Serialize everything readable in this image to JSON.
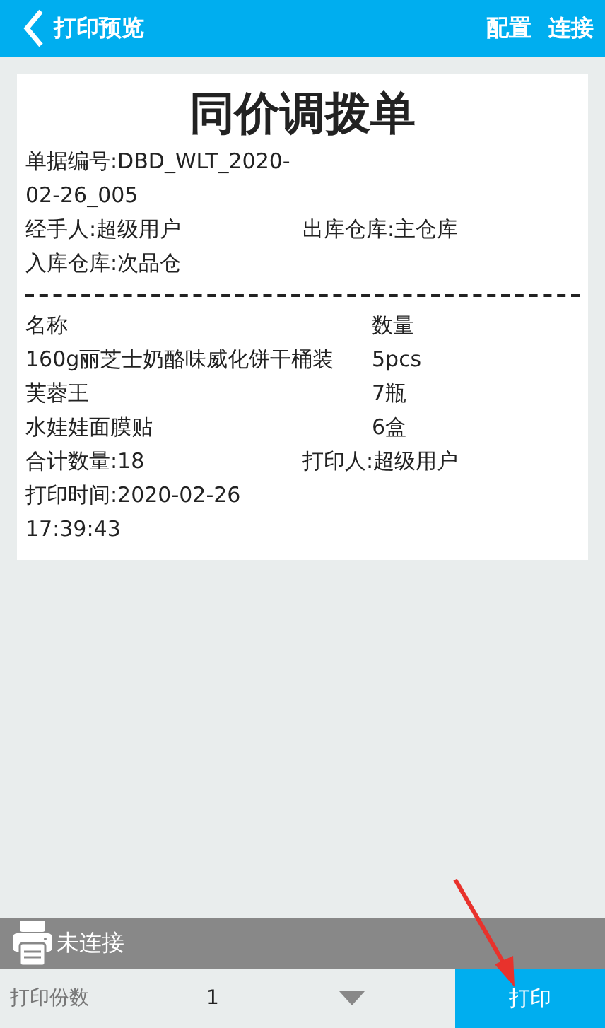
{
  "header": {
    "title": "打印预览",
    "actions": [
      "配置",
      "连接"
    ]
  },
  "receipt": {
    "title": "同价调拨单",
    "info_rows": [
      [
        "单据编号:DBD_WLT_2020-02-26_005"
      ],
      [
        "经手人:超级用户",
        "出库仓库:主仓库"
      ],
      [
        "入库仓库:次品仓"
      ]
    ],
    "columns": [
      "名称",
      "数量"
    ],
    "items": [
      {
        "name": "160g丽芝士奶酪味威化饼干桶装",
        "quantity": "5pcs"
      },
      {
        "name": "芙蓉王",
        "quantity": "7瓶"
      },
      {
        "name": "水娃娃面膜贴",
        "quantity": "6盒"
      }
    ],
    "footer_rows": [
      [
        "合计数量:18",
        "打印人:超级用户"
      ],
      [
        "打印时间:2020-02-26 17:39:43"
      ]
    ]
  },
  "status": {
    "text": "未连接"
  },
  "copies": {
    "label": "打印份数",
    "value": "1"
  },
  "print_button": "打印"
}
